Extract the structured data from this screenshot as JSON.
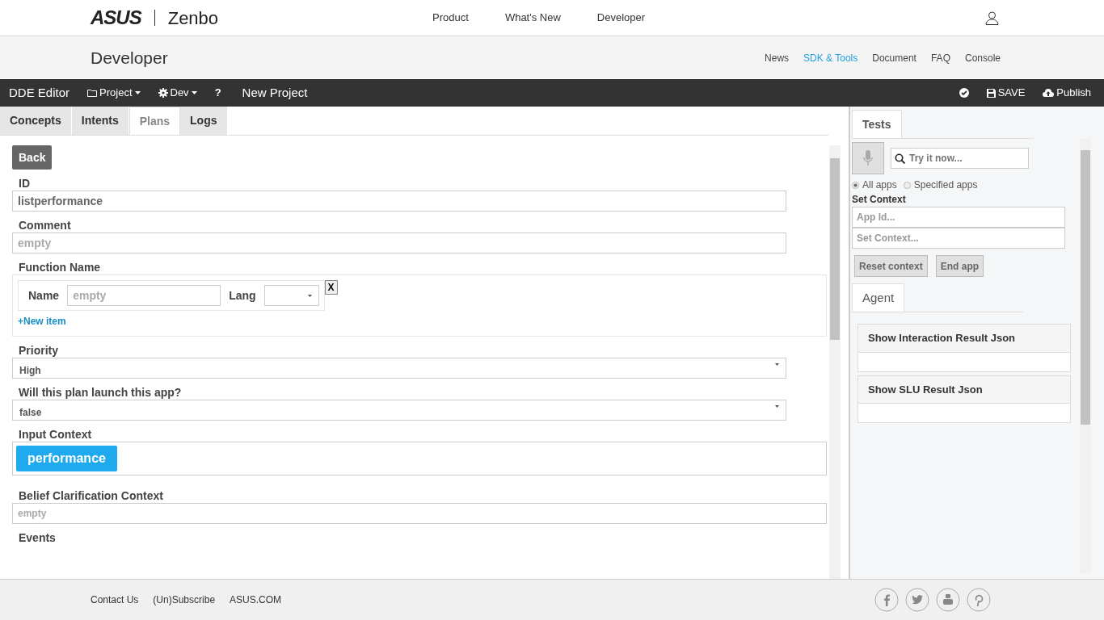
{
  "header": {
    "logo": "ASUS",
    "product": "Zenbo",
    "nav": [
      "Product",
      "What's New",
      "Developer"
    ]
  },
  "subheader": {
    "title": "Developer",
    "links": [
      {
        "label": "News",
        "selected": false
      },
      {
        "label": "SDK & Tools",
        "selected": true
      },
      {
        "label": "Document",
        "selected": false
      },
      {
        "label": "FAQ",
        "selected": false
      },
      {
        "label": "Console",
        "selected": false
      }
    ]
  },
  "toolbar": {
    "title": "DDE Editor",
    "menus": [
      {
        "label": "Project"
      },
      {
        "label": "Dev"
      }
    ],
    "help": "?",
    "project": "New Project",
    "save": "SAVE",
    "publish": "Publish"
  },
  "tabs": [
    {
      "label": "Concepts",
      "selected": false
    },
    {
      "label": "Intents",
      "selected": false
    },
    {
      "label": "Plans",
      "selected": true
    },
    {
      "label": "Logs",
      "selected": false
    }
  ],
  "form": {
    "back": "Back",
    "fields": [
      {
        "kind": "input",
        "label": "ID",
        "value": "listperformance"
      },
      {
        "kind": "input",
        "label": "Comment",
        "placeholder": "empty"
      },
      {
        "kind": "function",
        "label": "Function Name",
        "name_label": "Name",
        "name_placeholder": "empty",
        "lang_label": "Lang",
        "remove": "X",
        "add": "+New item"
      },
      {
        "kind": "select",
        "label": "Priority",
        "value": "High"
      },
      {
        "kind": "select",
        "label": "Will this plan launch this app?",
        "value": "false"
      },
      {
        "kind": "tags",
        "label": "Input Context",
        "tags": [
          "performance"
        ]
      },
      {
        "kind": "small-input",
        "label": "Belief Clarification Context",
        "placeholder": "empty"
      },
      {
        "kind": "heading",
        "label": "Events"
      }
    ]
  },
  "tests": {
    "tab": "Tests",
    "search_placeholder": "Try it now...",
    "scope": [
      {
        "label": "All apps",
        "selected": true
      },
      {
        "label": "Specified apps",
        "selected": false
      }
    ],
    "context_label": "Set Context",
    "app_id_placeholder": "App Id...",
    "context_placeholder": "Set Context...",
    "buttons": [
      "Reset context",
      "End app"
    ],
    "agent_tab": "Agent",
    "panels": [
      "Show Interaction Result Json",
      "Show SLU Result Json"
    ]
  },
  "footer": {
    "links": [
      "Contact Us",
      "(Un)Subscribe",
      "ASUS.COM"
    ]
  }
}
